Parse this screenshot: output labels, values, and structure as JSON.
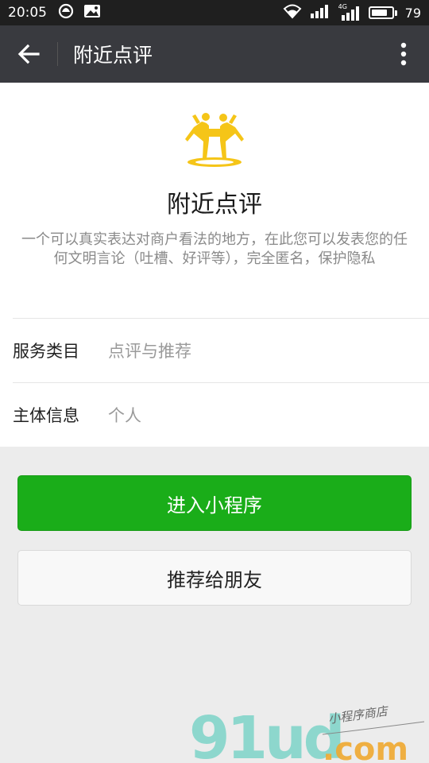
{
  "status_bar": {
    "time": "20:05",
    "network": "4G",
    "battery": "79",
    "battery_level": 0.79
  },
  "nav": {
    "title": "附近点评",
    "back_icon": "arrow-left-icon",
    "more_icon": "more-vertical-icon"
  },
  "app": {
    "name": "附近点评",
    "description": "一个可以真实表达对商户看法的地方，在此您可以发表您的任何文明言论（吐槽、好评等），完全匿名，保护隐私",
    "logo_icon": "people-cheering-icon",
    "logo_color": "#f5c518"
  },
  "details": [
    {
      "label": "服务类目",
      "value": "点评与推荐"
    },
    {
      "label": "主体信息",
      "value": "个人"
    }
  ],
  "actions": {
    "enter_label": "进入小程序",
    "recommend_label": "推荐给朋友",
    "primary_color": "#1aad19"
  },
  "watermark": {
    "brand": "91ud",
    "domain": ".com",
    "tagline": "小程序商店"
  }
}
